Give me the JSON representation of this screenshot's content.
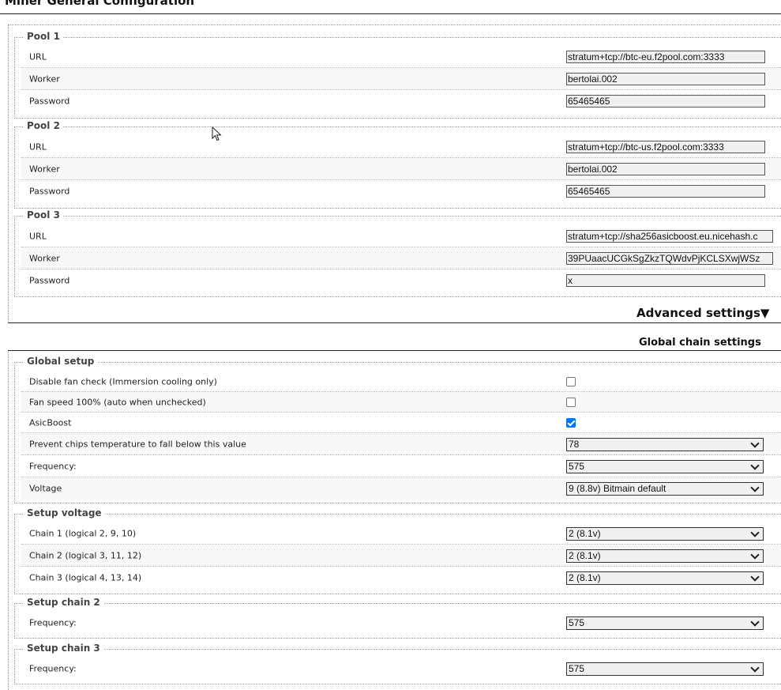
{
  "header": {
    "title": "Miner General Configuration"
  },
  "pools": [
    {
      "legend": "Pool 1",
      "url_label": "URL",
      "url": "stratum+tcp://btc-eu.f2pool.com:3333",
      "worker_label": "Worker",
      "worker": "bertolai.002",
      "password_label": "Password",
      "password": "65465465"
    },
    {
      "legend": "Pool 2",
      "url_label": "URL",
      "url": "stratum+tcp://btc-us.f2pool.com:3333",
      "worker_label": "Worker",
      "worker": "bertolai.002",
      "password_label": "Password",
      "password": "65465465"
    },
    {
      "legend": "Pool 3",
      "url_label": "URL",
      "url": "stratum+tcp://sha256asicboost.eu.nicehash.c",
      "worker_label": "Worker",
      "worker": "39PUaacUCGkSgZkzTQWdvPjKCLSXwjWSz",
      "password_label": "Password",
      "password": "x"
    }
  ],
  "advanced": {
    "label": "Advanced settings▼"
  },
  "global_chain": {
    "title": "Global chain settings"
  },
  "global_setup": {
    "legend": "Global setup",
    "disable_fan_check": {
      "label": "Disable fan check (Immersion cooling only)",
      "checked": false
    },
    "fan_speed": {
      "label": "Fan speed 100% (auto when unchecked)",
      "checked": false
    },
    "asicboost": {
      "label": "AsicBoost",
      "checked": true
    },
    "min_temp": {
      "label": "Prevent chips temperature to fall below this value",
      "value": "78"
    },
    "frequency": {
      "label": "Frequency:",
      "value": "575"
    },
    "voltage": {
      "label": "Voltage",
      "value": "9 (8.8v) Bitmain default"
    }
  },
  "setup_voltage": {
    "legend": "Setup voltage",
    "chains": [
      {
        "label": "Chain 1 (logical 2, 9, 10)",
        "value": "2 (8.1v)"
      },
      {
        "label": "Chain 2 (logical 3, 11, 12)",
        "value": "2 (8.1v)"
      },
      {
        "label": "Chain 3 (logical 4, 13, 14)",
        "value": "2 (8.1v)"
      }
    ]
  },
  "setup_chain2": {
    "legend": "Setup chain 2",
    "frequency_label": "Frequency:",
    "frequency": "575"
  },
  "setup_chain3": {
    "legend": "Setup chain 3",
    "frequency_label": "Frequency:",
    "frequency": "575"
  },
  "colors": {
    "checkbox_checked": "#0075ff",
    "border": "#999999"
  }
}
